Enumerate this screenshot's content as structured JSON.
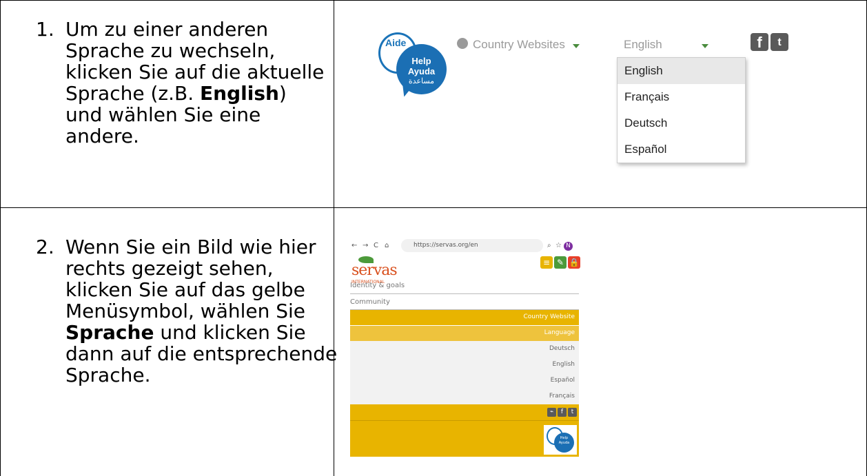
{
  "steps": [
    {
      "number": "1.",
      "text_before": "Um zu einer anderen Sprache zu wechseln, klicken Sie auf die aktuelle Sprache (z.B. ",
      "bold": "English",
      "text_after": ") und wählen Sie eine andere."
    },
    {
      "number": "2.",
      "text_before": "Wenn Sie ein Bild wie hier rechts gezeigt sehen, klicken Sie auf das gelbe Menüsymbol, wählen Sie ",
      "bold": "Sprache",
      "text_after": " und klicken Sie dann auf die entsprechende Sprache."
    }
  ],
  "shot1": {
    "help_bubble": {
      "aide": "Aide",
      "help": "Help",
      "ayuda": "Ayuda",
      "arabic": "مساعدة"
    },
    "country_websites": "Country Websites",
    "current_language": "English",
    "dropdown": [
      "English",
      "Français",
      "Deutsch",
      "Español"
    ],
    "social_icons": [
      "facebook-icon",
      "twitter-icon"
    ],
    "colors": {
      "caret": "#4a8c3e",
      "help_blue": "#1b6fb4"
    }
  },
  "shot2": {
    "browser": {
      "url": "https://servas.org/en"
    },
    "avatar_letter": "N",
    "logo": {
      "name": "servas",
      "sub": "INTERNATIONAL"
    },
    "menu_rows": [
      "Identity & goals",
      "Community"
    ],
    "country_website": "Country Website",
    "language_label": "Language",
    "languages": [
      "Deutsch",
      "English",
      "Español",
      "Français"
    ],
    "help_bubble": {
      "aide": "Aide",
      "help": "Help",
      "ayuda": "Ayuda"
    },
    "colors": {
      "yellow": "#e8b400",
      "green": "#4c9a3a",
      "red": "#e8402a"
    }
  }
}
